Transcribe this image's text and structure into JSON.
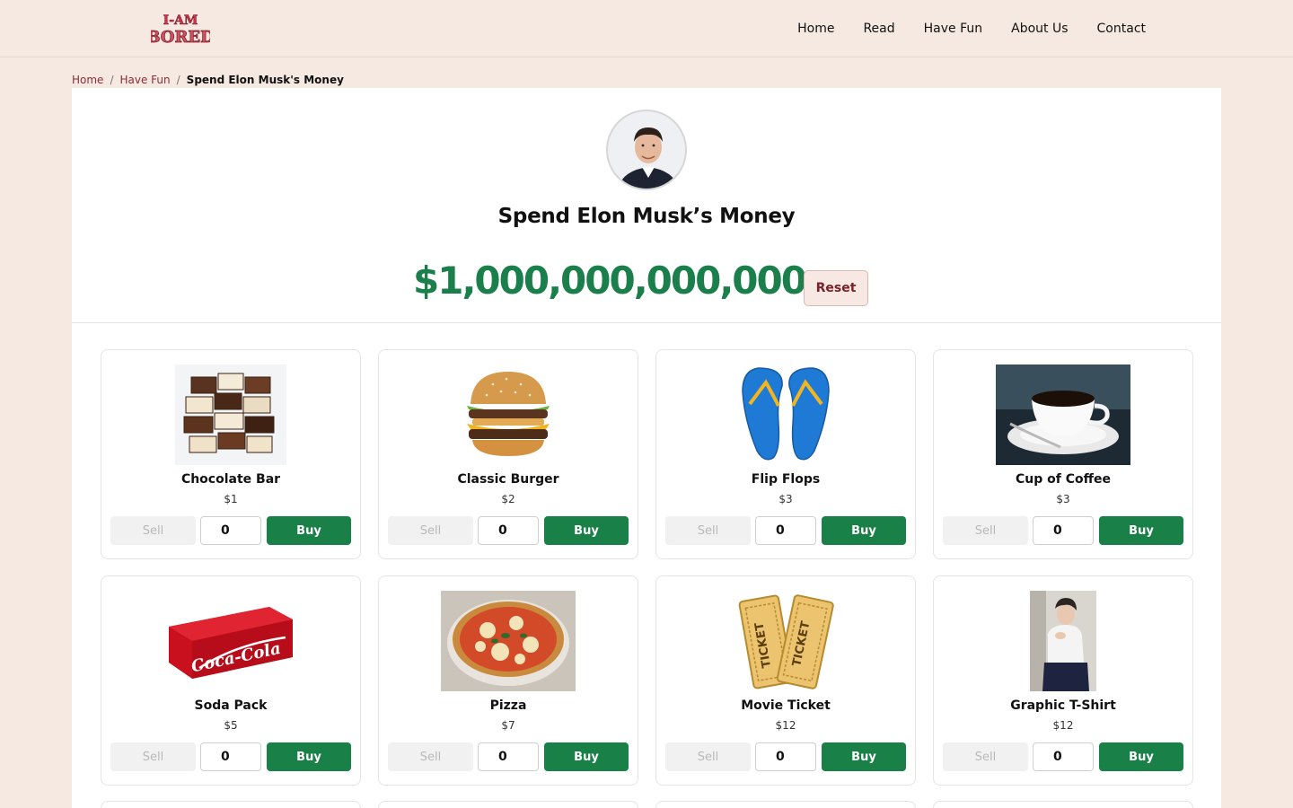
{
  "header": {
    "logo_text": "I-AM BORED",
    "nav": [
      "Home",
      "Read",
      "Have Fun",
      "About Us",
      "Contact"
    ]
  },
  "breadcrumb": {
    "items": [
      "Home",
      "Have Fun"
    ],
    "separator": "/",
    "current": "Spend Elon Musk's Money"
  },
  "hero": {
    "title": "Spend Elon Musk’s Money",
    "balance": "$1,000,000,000,000",
    "reset_label": "Reset"
  },
  "colors": {
    "background": "#f6e9e2",
    "money_green": "#1a7f4b",
    "buy_green": "#198047",
    "brand_red": "#8a2d35"
  },
  "products": [
    {
      "name": "Chocolate Bar",
      "price": "$1",
      "qty": "0",
      "icon": "chocolate-image"
    },
    {
      "name": "Classic Burger",
      "price": "$2",
      "qty": "0",
      "icon": "burger-image"
    },
    {
      "name": "Flip Flops",
      "price": "$3",
      "qty": "0",
      "icon": "flip-flops-image"
    },
    {
      "name": "Cup of Coffee",
      "price": "$3",
      "qty": "0",
      "icon": "coffee-image"
    },
    {
      "name": "Soda Pack",
      "price": "$5",
      "qty": "0",
      "icon": "soda-pack-image"
    },
    {
      "name": "Pizza",
      "price": "$7",
      "qty": "0",
      "icon": "pizza-image"
    },
    {
      "name": "Movie Ticket",
      "price": "$12",
      "qty": "0",
      "icon": "movie-ticket-image"
    },
    {
      "name": "Graphic T-Shirt",
      "price": "$12",
      "qty": "0",
      "icon": "t-shirt-image"
    }
  ],
  "labels": {
    "sell": "Sell",
    "buy": "Buy"
  }
}
